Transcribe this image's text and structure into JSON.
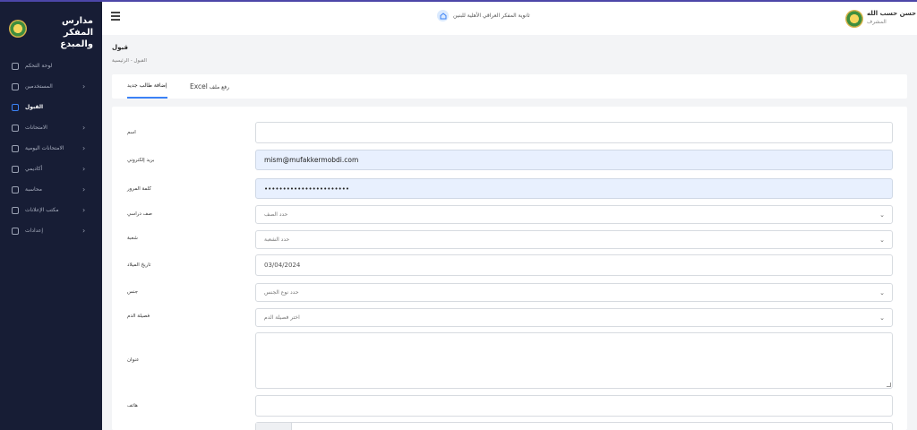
{
  "brand": {
    "title": "مدارس المفكر والمبدع"
  },
  "header": {
    "school_name": "ثانوية المفكر العراقي الأهلية للبنين",
    "user_name": "حسن حسب الله",
    "user_role": "المشرف"
  },
  "sidebar": {
    "items": [
      {
        "label": "لوحة التحكم",
        "icon": "dashboard-icon",
        "chevron": "",
        "active": false
      },
      {
        "label": "المستخدمين",
        "icon": "users-icon",
        "chevron": "›",
        "active": false
      },
      {
        "label": "القبول",
        "icon": "user-plus-icon",
        "chevron": "",
        "active": true
      },
      {
        "label": "الامتحانات",
        "icon": "exam-icon",
        "chevron": "›",
        "active": false
      },
      {
        "label": "الامتحانات اليومية",
        "icon": "daily-exam-icon",
        "chevron": "›",
        "active": false
      },
      {
        "label": "أكاديمي",
        "icon": "academic-icon",
        "chevron": "›",
        "active": false
      },
      {
        "label": "محاسبة",
        "icon": "accounting-icon",
        "chevron": "›",
        "active": false
      },
      {
        "label": "مكتب الإعلانات",
        "icon": "briefcase-icon",
        "chevron": "›",
        "active": false
      },
      {
        "label": "إعدادات",
        "icon": "gear-icon",
        "chevron": "›",
        "active": false
      }
    ]
  },
  "page": {
    "title": "قبول",
    "breadcrumb": "القبول  -  الرئيسية"
  },
  "tabs": {
    "add_student": "إضافة طالب جديد",
    "upload_prefix": "رفع ملف",
    "upload_suffix": "Excel"
  },
  "form": {
    "name_label": "اسم",
    "name_value": "",
    "email_label": "بريد إلكتروني",
    "email_value": "mism@mufakkermobdi.com",
    "password_label": "كلمة المرور",
    "password_value": "•••••••••••••••••••••••",
    "class_label": "صف دراسي",
    "class_placeholder": "حدد الصف",
    "section_label": "شعبة",
    "section_placeholder": "حدد الشعبة",
    "birthdate_label": "تاريخ الميلاد",
    "birthdate_value": "03/04/2024",
    "gender_label": "جنس",
    "gender_placeholder": "حدد نوع الجنس",
    "blood_label": "فصيلة الدم",
    "blood_placeholder": "اختر فصيلة الدم",
    "address_label": "عنوان",
    "address_value": "",
    "phone_label": "هاتف",
    "phone_value": ""
  }
}
